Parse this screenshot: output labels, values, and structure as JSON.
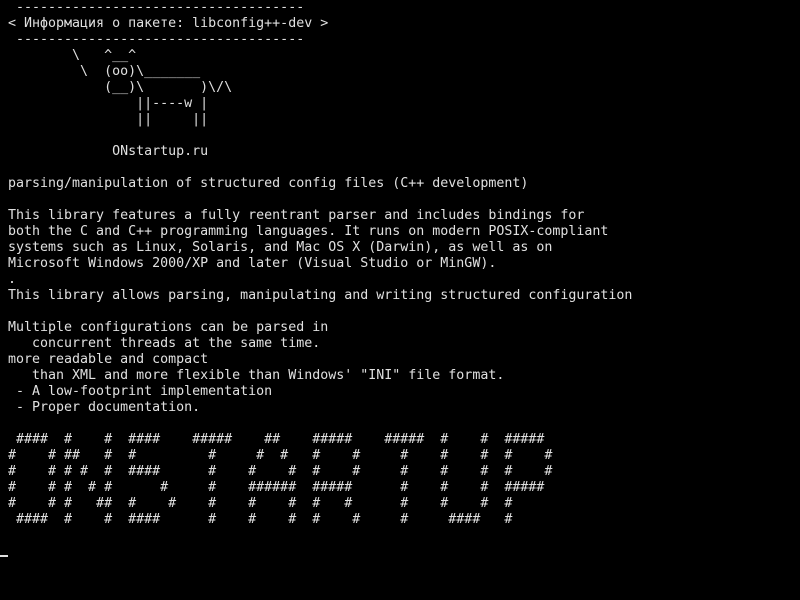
{
  "terminal": {
    "lines": [
      " ------------------------------------",
      "< Информация о пакете: libconfig++-dev >",
      " ------------------------------------",
      "        \\   ^__^",
      "         \\  (oo)\\_______",
      "            (__)\\       )\\/\\",
      "                ||----w |",
      "                ||     ||",
      "",
      "             ONstartup.ru",
      "",
      "parsing/manipulation of structured config files (C++ development)",
      "",
      "This library features a fully reentrant parser and includes bindings for",
      "both the C and C++ programming languages. It runs on modern POSIX-compliant",
      "systems such as Linux, Solaris, and Mac OS X (Darwin), as well as on",
      "Microsoft Windows 2000/XP and later (Visual Studio or MinGW).",
      ".",
      "This library allows parsing, manipulating and writing structured configuration",
      "",
      "Multiple configurations can be parsed in",
      "   concurrent threads at the same time.",
      "more readable and compact",
      "   than XML and more flexible than Windows' \"INI\" file format.",
      " - A low-footprint implementation",
      " - Proper documentation.",
      "",
      " ####  #    #  ####    #####    ##    #####    #####  #    #  #####",
      "#    # ##   #  #         #     #  #   #    #     #    #    #  #    #",
      "#    # # #  #  ####      #    #    #  #    #     #    #    #  #    #",
      "#    # #  # #      #     #    ######  #####      #    #    #  #####",
      "#    # #   ##  #    #    #    #    #  #   #      #    #    #  #",
      " ####  #    #  ####      #    #    #  #    #     #     ####   #"
    ]
  }
}
